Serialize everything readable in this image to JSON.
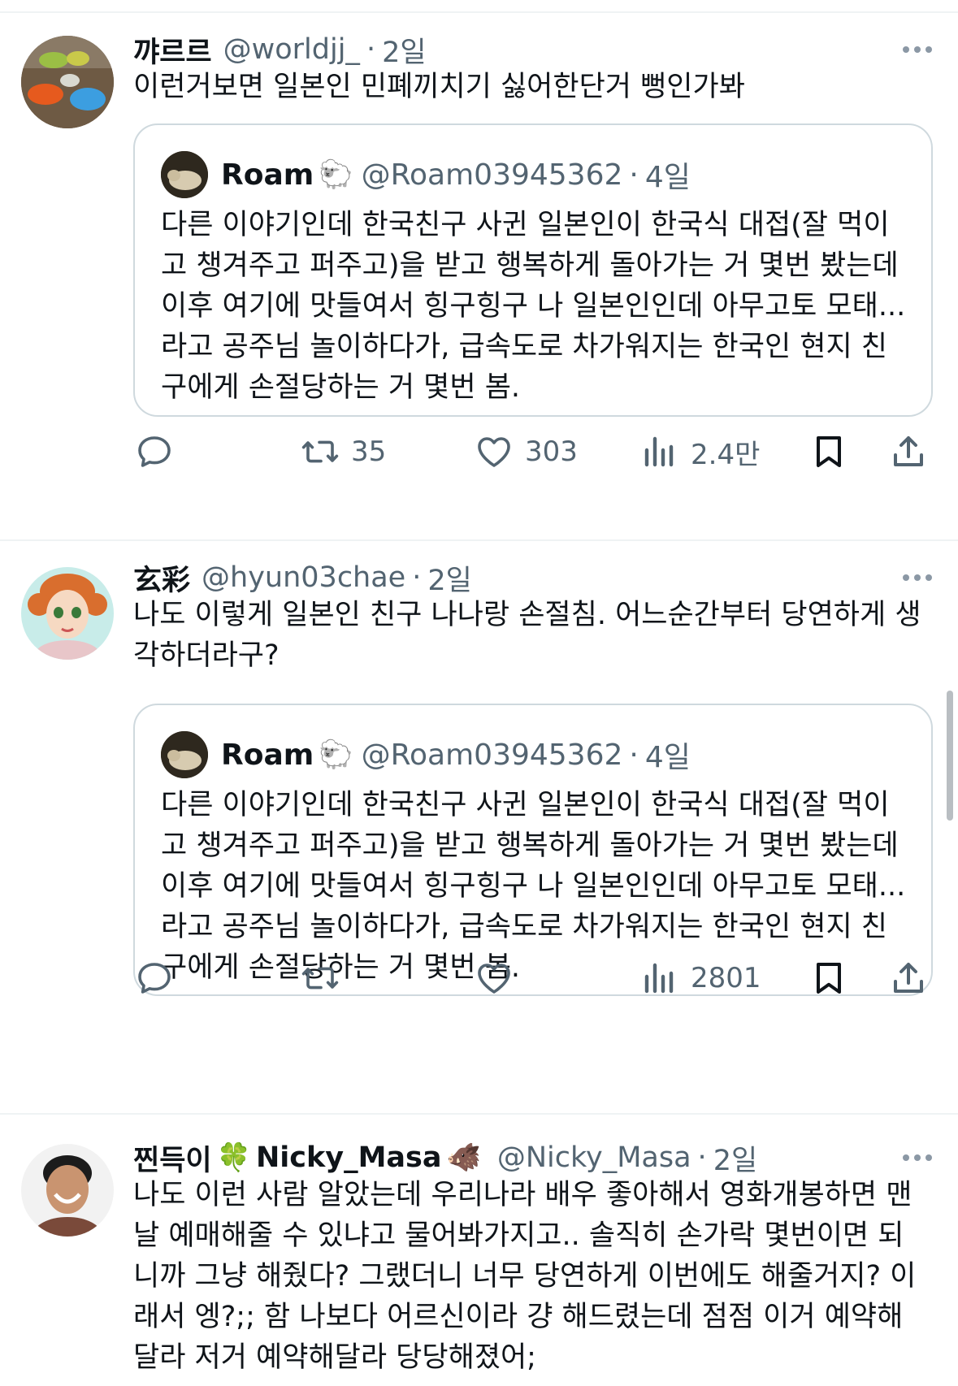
{
  "tweets": [
    {
      "display_name": "꺄르르",
      "handle": "@worldjj_",
      "dot": "·",
      "time": "2일",
      "text": "이런거보면 일본인 민폐끼치기 싫어한단거 뻥인가봐",
      "quote": {
        "display_name": "Roam",
        "emoji": "🐑",
        "handle": "@Roam03945362",
        "dot": "·",
        "time": "4일",
        "text": "다른 이야기인데 한국친구 사귄 일본인이 한국식 대접(잘 먹이고 챙겨주고 퍼주고)을 받고 행복하게 돌아가는 거 몇번 봤는데 이후 여기에 맛들여서 힝구힝구 나 일본인인데 아무고토 모태... 라고 공주님 놀이하다가, 급속도로 차가워지는 한국인 현지 친구에게 손절당하는 거 몇번 봄."
      },
      "actions": {
        "replies": "",
        "reposts": "35",
        "likes": "303",
        "views": "2.4만"
      }
    },
    {
      "display_name": "玄彩",
      "handle": "@hyun03chae",
      "dot": "·",
      "time": "2일",
      "text": "나도 이렇게 일본인 친구 나나랑 손절침. 어느순간부터 당연하게 생각하더라구?",
      "quote": {
        "display_name": "Roam",
        "emoji": "🐑",
        "handle": "@Roam03945362",
        "dot": "·",
        "time": "4일",
        "text": "다른 이야기인데 한국친구 사귄 일본인이 한국식 대접(잘 먹이고 챙겨주고 퍼주고)을 받고 행복하게 돌아가는 거 몇번 봤는데 이후 여기에 맛들여서 힝구힝구 나 일본인인데 아무고토 모태... 라고 공주님 놀이하다가, 급속도로 차가워지는 한국인 현지 친구에게 손절당하는 거 몇번 봄."
      },
      "actions": {
        "replies": "",
        "reposts": "",
        "likes": "",
        "views": "2801"
      }
    },
    {
      "display_name_prefix": "찐득이",
      "emoji_clover": "🍀",
      "display_name": "Nicky_Masa",
      "emoji_boar": "🐗",
      "handle": "@Nicky_Masa",
      "dot": "·",
      "time": "2일",
      "text": "나도 이런 사람 알았는데 우리나라 배우 좋아해서 영화개봉하면 맨날 예매해줄 수 있냐고 물어봐가지고.. 솔직히 손가락 몇번이면 되니까 그냥 해줬다? 그랬더니 너무 당연하게 이번에도 해줄거지? 이래서 엥?;; 함 나보다 어르신이라 걍 해드렸는데 점점 이거 예약해달라 저거 예약해달라 당당해졌어;"
    }
  ],
  "icons": [
    "more-icon",
    "reply-icon",
    "repost-icon",
    "like-icon",
    "views-icon",
    "bookmark-icon",
    "share-icon"
  ],
  "colors": {
    "text": "#0f1419",
    "secondary": "#536471",
    "border": "#cfd9de"
  }
}
